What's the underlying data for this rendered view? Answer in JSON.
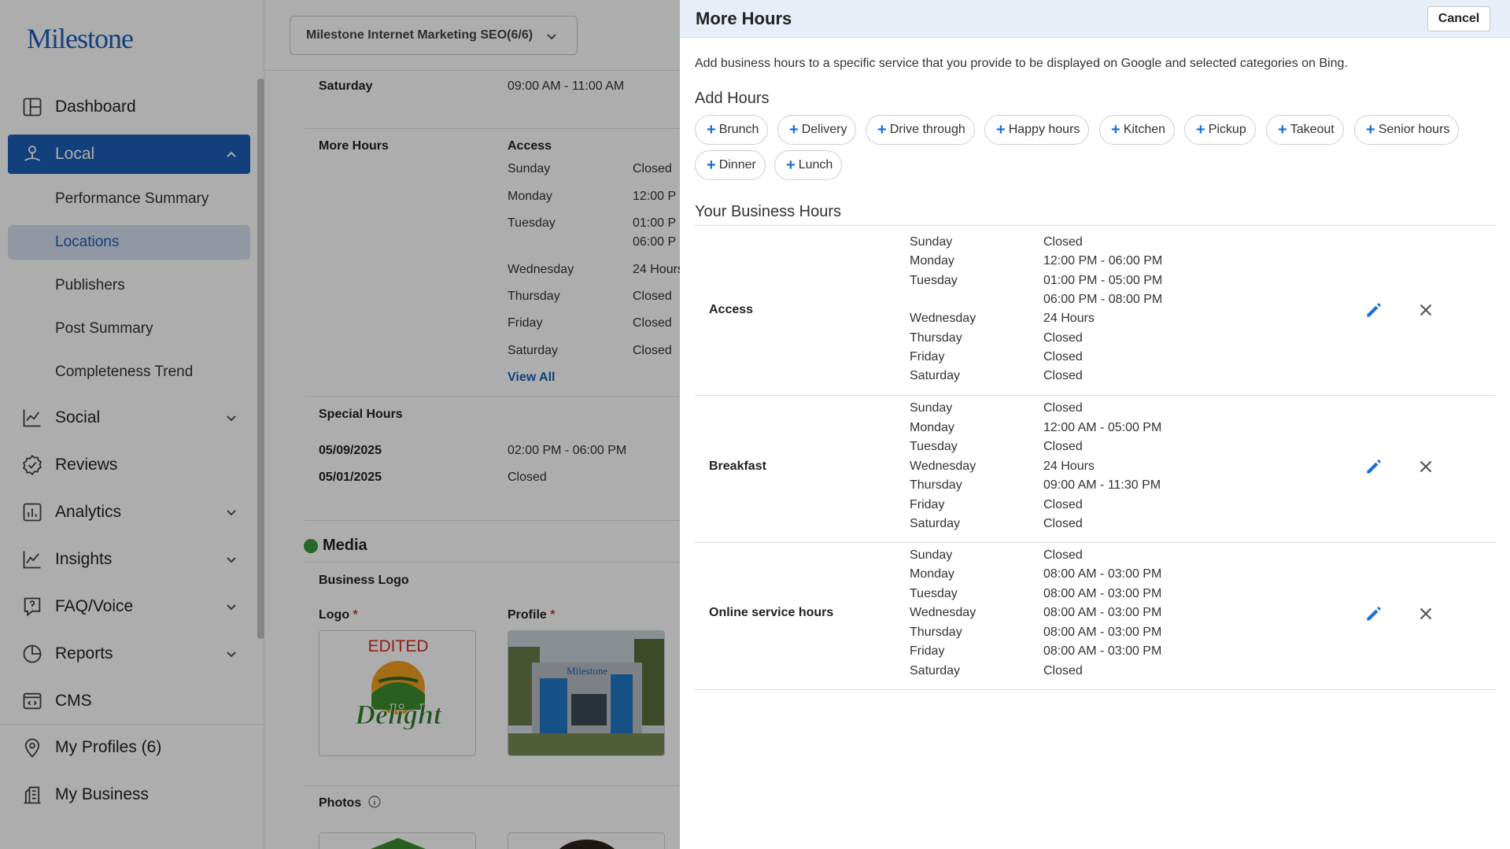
{
  "sidebar": {
    "logo": "Milestone",
    "items": [
      {
        "label": "Dashboard",
        "icon": "dashboard-icon"
      },
      {
        "label": "Local",
        "icon": "local-pin-icon"
      },
      {
        "label": "Social",
        "icon": "social-chart-icon"
      },
      {
        "label": "Reviews",
        "icon": "reviews-badge-icon"
      },
      {
        "label": "Analytics",
        "icon": "analytics-icon"
      },
      {
        "label": "Insights",
        "icon": "insights-icon"
      },
      {
        "label": "FAQ/Voice",
        "icon": "faq-voice-icon"
      },
      {
        "label": "Reports",
        "icon": "reports-icon"
      },
      {
        "label": "CMS",
        "icon": "cms-icon"
      },
      {
        "label": "My Profiles (6)",
        "icon": "profile-pin-icon"
      },
      {
        "label": "My Business",
        "icon": "business-icon"
      }
    ],
    "local_sub_items": [
      "Performance Summary",
      "Locations",
      "Publishers",
      "Post Summary",
      "Completeness Trend"
    ],
    "selected_sub_item": "Locations",
    "accent_color": "#1b5fb8"
  },
  "main": {
    "profile_select": "Milestone Internet Marketing SEO(6/6)",
    "saturday_label": "Saturday",
    "saturday_value": "09:00 AM - 11:00 AM",
    "more_hours_label": "More Hours",
    "more_hours_group": "Access",
    "more_hours_rows": [
      {
        "day": "Sunday",
        "time": "Closed"
      },
      {
        "day": "Monday",
        "time": "12:00 P"
      },
      {
        "day": "Tuesday",
        "time": "01:00 P"
      },
      {
        "day": "",
        "time": "06:00 P"
      },
      {
        "day": "Wednesday",
        "time": "24 Hours"
      },
      {
        "day": "Thursday",
        "time": "Closed"
      },
      {
        "day": "Friday",
        "time": "Closed"
      },
      {
        "day": "Saturday",
        "time": "Closed"
      }
    ],
    "view_all": "View All",
    "special_hours_label": "Special Hours",
    "special_hours": [
      {
        "date": "05/09/2025",
        "time": "02:00 PM - 06:00 PM"
      },
      {
        "date": "05/01/2025",
        "time": "Closed"
      }
    ],
    "media_title": "Media",
    "business_logo_label": "Business Logo",
    "logo_label": "Logo",
    "profile_label": "Profile",
    "required_mark": "*",
    "logo_text_top": "EDITED",
    "logo_text_brand": "Delight",
    "photos_label": "Photos"
  },
  "drawer": {
    "title": "More Hours",
    "cancel_label": "Cancel",
    "description": "Add business hours to a specific service that you provide to be displayed on Google and selected categories on Bing.",
    "add_hours_title": "Add Hours",
    "chips": [
      "Brunch",
      "Delivery",
      "Drive through",
      "Happy hours",
      "Kitchen",
      "Pickup",
      "Takeout",
      "Senior hours",
      "Dinner",
      "Lunch"
    ],
    "your_hours_title": "Your Business Hours",
    "groups": [
      {
        "name": "Access",
        "rows": [
          {
            "day": "Sunday",
            "time": "Closed"
          },
          {
            "day": "Monday",
            "time": "12:00 PM - 06:00 PM"
          },
          {
            "day": "Tuesday",
            "time": "01:00 PM - 05:00 PM"
          },
          {
            "day": "",
            "time": "06:00 PM - 08:00 PM"
          },
          {
            "day": "Wednesday",
            "time": "24 Hours"
          },
          {
            "day": "Thursday",
            "time": "Closed"
          },
          {
            "day": "Friday",
            "time": "Closed"
          },
          {
            "day": "Saturday",
            "time": "Closed"
          }
        ]
      },
      {
        "name": "Breakfast",
        "rows": [
          {
            "day": "Sunday",
            "time": "Closed"
          },
          {
            "day": "Monday",
            "time": "12:00 AM - 05:00 PM"
          },
          {
            "day": "Tuesday",
            "time": "Closed"
          },
          {
            "day": "Wednesday",
            "time": "24 Hours"
          },
          {
            "day": "Thursday",
            "time": "09:00 AM - 11:30 PM"
          },
          {
            "day": "Friday",
            "time": "Closed"
          },
          {
            "day": "Saturday",
            "time": "Closed"
          }
        ]
      },
      {
        "name": "Online service hours",
        "rows": [
          {
            "day": "Sunday",
            "time": "Closed"
          },
          {
            "day": "Monday",
            "time": "08:00 AM - 03:00 PM"
          },
          {
            "day": "Tuesday",
            "time": "08:00 AM - 03:00 PM"
          },
          {
            "day": "Wednesday",
            "time": "08:00 AM - 03:00 PM"
          },
          {
            "day": "Thursday",
            "time": "08:00 AM - 03:00 PM"
          },
          {
            "day": "Friday",
            "time": "08:00 AM - 03:00 PM"
          },
          {
            "day": "Saturday",
            "time": "Closed"
          }
        ]
      }
    ],
    "action_icons": {
      "edit": "pencil-icon",
      "delete": "close-icon"
    },
    "accent_color": "#1b6fd6"
  }
}
